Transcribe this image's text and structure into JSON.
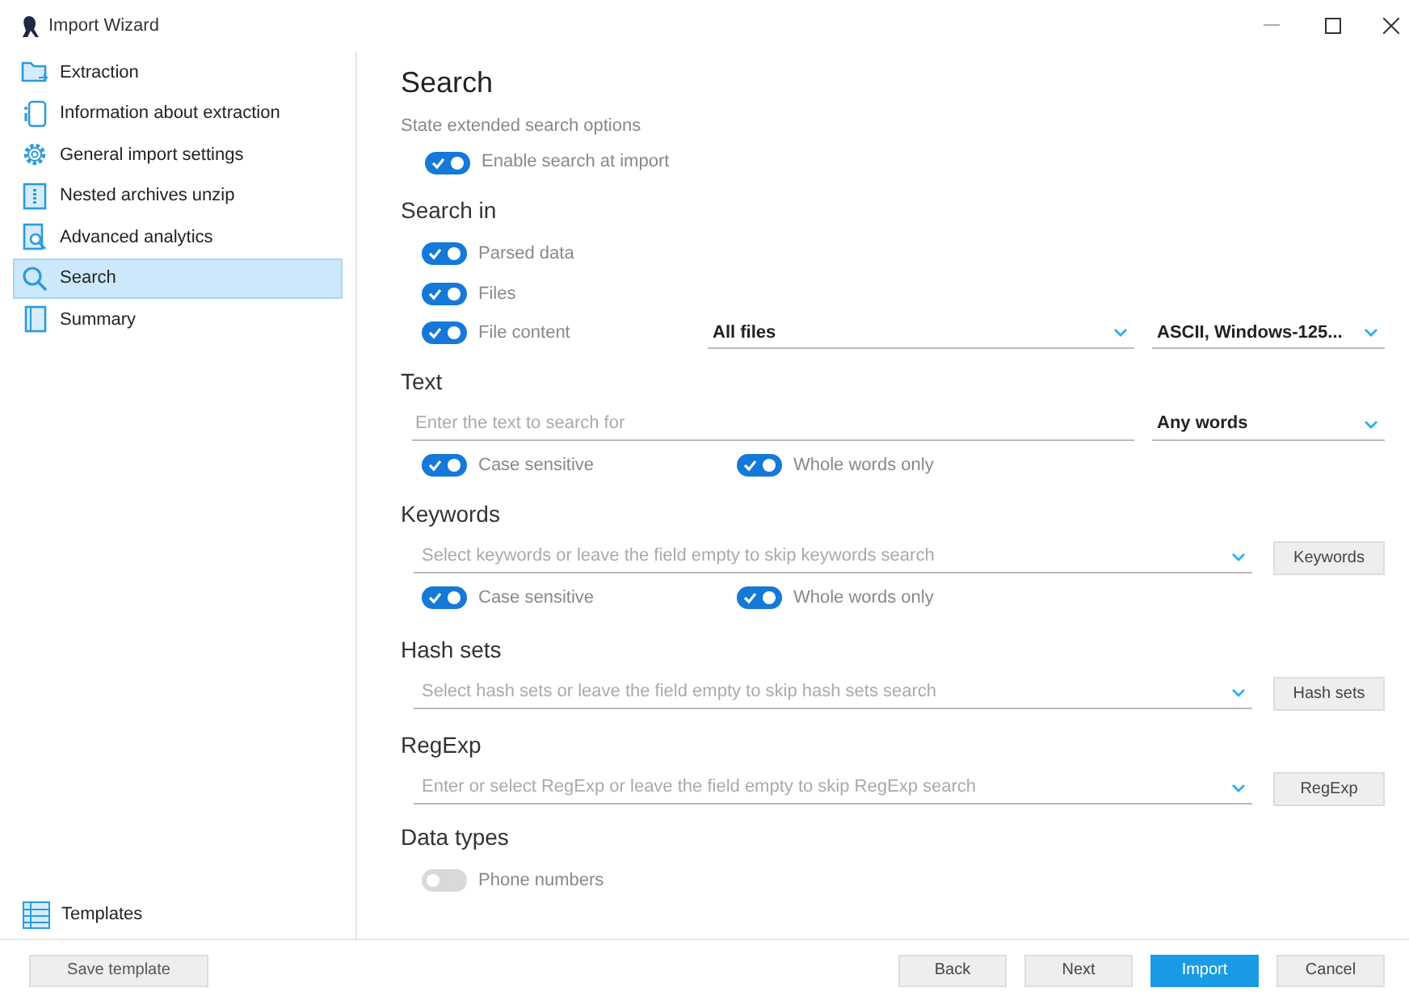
{
  "window": {
    "title": "Import Wizard"
  },
  "sidebar": {
    "items": [
      {
        "label": "Extraction",
        "selected": false
      },
      {
        "label": "Information about extraction",
        "selected": false
      },
      {
        "label": "General import settings",
        "selected": false
      },
      {
        "label": "Nested archives unzip",
        "selected": false
      },
      {
        "label": "Advanced analytics",
        "selected": false
      },
      {
        "label": "Search",
        "selected": true
      },
      {
        "label": "Summary",
        "selected": false
      }
    ],
    "templates": "Templates"
  },
  "page": {
    "title": "Search",
    "subtitle": "State extended search options",
    "enable": {
      "label": "Enable search at import",
      "on": true
    },
    "search_in": {
      "heading": "Search in",
      "toggles": [
        {
          "label": "Parsed data",
          "on": true
        },
        {
          "label": "Files",
          "on": true
        },
        {
          "label": "File content",
          "on": true
        }
      ],
      "file_filter": {
        "value": "All files"
      },
      "encoding": {
        "value": "ASCII,  Windows-125..."
      }
    },
    "text": {
      "heading": "Text",
      "field": {
        "placeholder": "Enter the text to search for"
      },
      "mode": {
        "value": "Any words"
      },
      "options": [
        {
          "label": "Case sensitive",
          "on": true
        },
        {
          "label": "Whole words only",
          "on": true
        }
      ]
    },
    "keywords": {
      "heading": "Keywords",
      "field": {
        "placeholder": "Select keywords or leave the field empty to skip keywords search"
      },
      "button": "Keywords",
      "options": [
        {
          "label": "Case sensitive",
          "on": true
        },
        {
          "label": "Whole words only",
          "on": true
        }
      ]
    },
    "hash_sets": {
      "heading": "Hash sets",
      "field": {
        "placeholder": "Select hash sets or leave the field empty to skip hash sets search"
      },
      "button": "Hash sets"
    },
    "regexp": {
      "heading": "RegExp",
      "field": {
        "placeholder": "Enter or select RegExp or leave the field empty to skip RegExp search"
      },
      "button": "RegExp"
    },
    "data_types": {
      "heading": "Data types",
      "toggles": [
        {
          "label": "Phone numbers",
          "on": false
        }
      ]
    }
  },
  "footer": {
    "save_template": "Save template",
    "buttons": [
      {
        "label": "Back",
        "kind": "default"
      },
      {
        "label": "Next",
        "kind": "default"
      },
      {
        "label": "Import",
        "kind": "primary"
      },
      {
        "label": "Cancel",
        "kind": "default"
      }
    ]
  }
}
